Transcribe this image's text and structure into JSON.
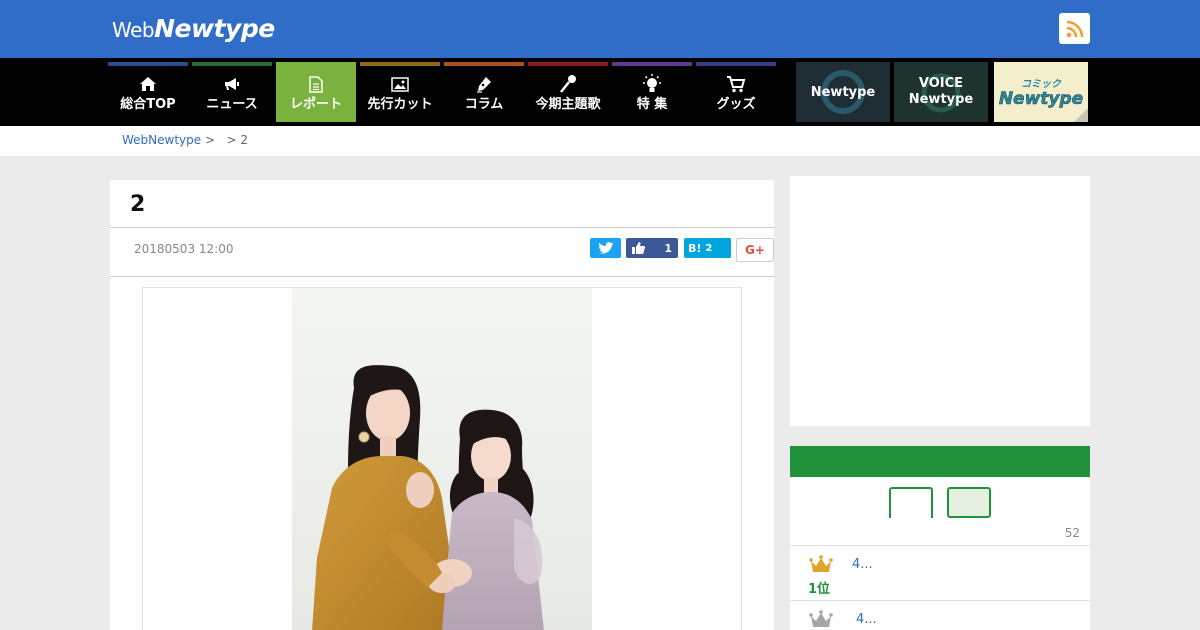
{
  "header": {
    "logo_web": "Web",
    "logo_newtype": "Newtype",
    "rss_icon": "rss-icon",
    "bg_color": "#2f6dc8"
  },
  "nav": {
    "items": [
      {
        "label": "総合TOP",
        "icon": "home-icon",
        "accent": "#2a4d8f"
      },
      {
        "label": "ニュース",
        "icon": "megaphone-icon",
        "accent": "#2d6b35"
      },
      {
        "label": "レポート",
        "icon": "document-icon",
        "accent": "#7ab23d",
        "active": true
      },
      {
        "label": "先行カット",
        "icon": "image-icon",
        "accent": "#8a6a1a"
      },
      {
        "label": "コラム",
        "icon": "pen-icon",
        "accent": "#b0521f"
      },
      {
        "label": "今期主題歌",
        "icon": "microphone-icon",
        "accent": "#8a1a25"
      },
      {
        "label": "特 集",
        "icon": "lightbulb-icon",
        "accent": "#5a3a8a"
      },
      {
        "label": "グッズ",
        "icon": "cart-icon",
        "accent": "#3a3a8a"
      }
    ],
    "brands": [
      {
        "label": "Newtype"
      },
      {
        "label1": "VOICE",
        "label2": "Newtype"
      },
      {
        "label1": "コミック",
        "label2": "Newtype"
      }
    ]
  },
  "breadcrumb": {
    "home": "WebNewtype",
    "sep1": ">",
    "sep2": ">",
    "current": "2"
  },
  "article": {
    "title": "2",
    "date": "20180503 12:00",
    "share": {
      "facebook_count": "1",
      "hatena_label": "B!",
      "hatena_count": "2",
      "googleplus_label": "G+"
    }
  },
  "sidebar": {
    "ranking": {
      "count": "52",
      "items": [
        {
          "position": "1位",
          "text": "4..."
        },
        {
          "text": "4..."
        }
      ],
      "accent": "#22913c"
    }
  }
}
